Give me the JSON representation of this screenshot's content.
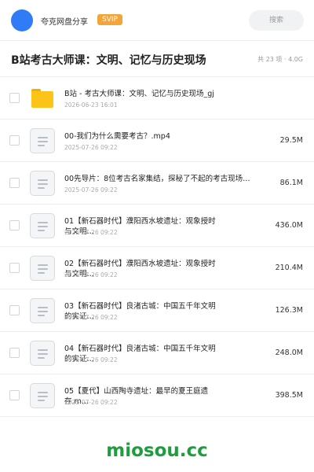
{
  "topbar": {
    "username": "夸克网盘分享",
    "badge": "SVIP",
    "search_placeholder": "搜索",
    "accent_color": "#2f7cf6",
    "badge_color": "#f4a53a"
  },
  "header": {
    "title": "B站考古大师课：文明、记忆与历史现场",
    "count": "共 23 项",
    "total_size": "4.0G"
  },
  "files": [
    {
      "type": "folder",
      "name": "B站 - 考古大师课：文明、记忆与历史现场_gj",
      "date": "2026-06-23 16:01",
      "size": ""
    },
    {
      "type": "file",
      "name": "00-我们为什么需要考古？.mp4",
      "date": "2025-07-26 09:22",
      "size": "29.5M"
    },
    {
      "type": "file",
      "name": "00先导片：8位考古名家集结，探秘了不起的考古现场…",
      "date": "2025-07-26 09:22",
      "size": "86.1M"
    },
    {
      "type": "file",
      "name": "01【新石器时代】濮阳西水坡遗址：观象授时与文明…",
      "date": "2025-07-26 09:22",
      "size": "436.0M"
    },
    {
      "type": "file",
      "name": "02【新石器时代】濮阳西水坡遗址：观象授时与文明…",
      "date": "2025-07-26 09:22",
      "size": "210.4M"
    },
    {
      "type": "file",
      "name": "03【新石器时代】良渚古城：中国五千年文明的实证…",
      "date": "2025-07-26 09:22",
      "size": "126.3M"
    },
    {
      "type": "file",
      "name": "04【新石器时代】良渚古城：中国五千年文明的实证…",
      "date": "2025-07-26 09:22",
      "size": "248.0M"
    },
    {
      "type": "file",
      "name": "05【夏代】山西陶寺遗址：最早的夏王庭遗存.m…",
      "date": "2025-07-26 09:22",
      "size": "398.5M"
    }
  ],
  "footer": {
    "brand": "miosou.cc",
    "brand_color": "#1f9c3d"
  }
}
